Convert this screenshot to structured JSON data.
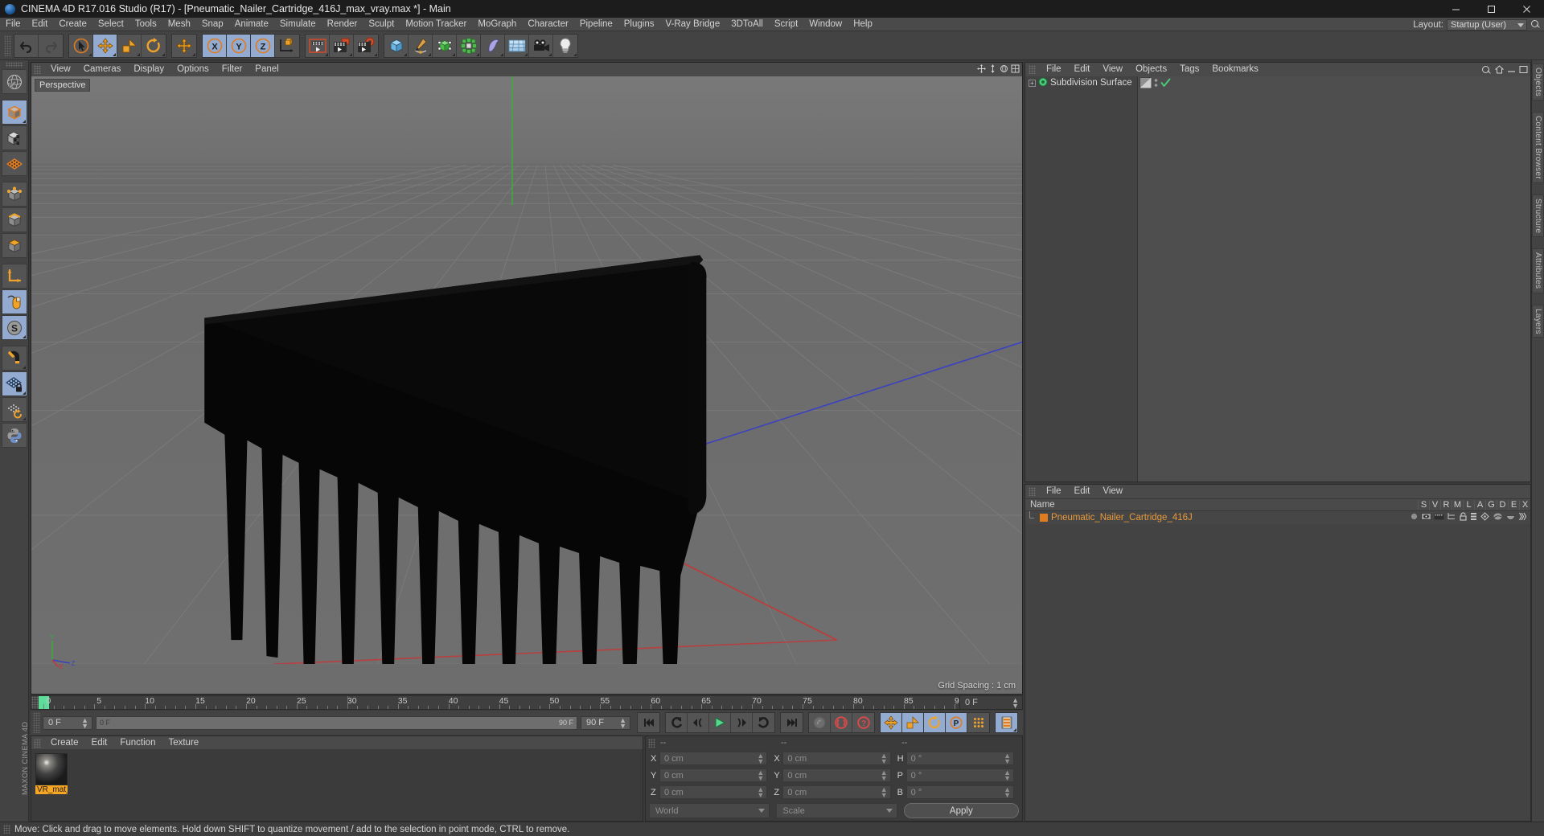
{
  "window": {
    "title": "CINEMA 4D R17.016 Studio (R17) - [Pneumatic_Nailer_Cartridge_416J_max_vray.max *] - Main",
    "minimize": "─",
    "maximize": "☐",
    "close": "✕"
  },
  "menubar": {
    "items": [
      "File",
      "Edit",
      "Create",
      "Select",
      "Tools",
      "Mesh",
      "Snap",
      "Animate",
      "Simulate",
      "Render",
      "Sculpt",
      "Motion Tracker",
      "MoGraph",
      "Character",
      "Pipeline",
      "Plugins",
      "V-Ray Bridge",
      "3DToAll",
      "Script",
      "Window",
      "Help"
    ],
    "layout_label": "Layout:",
    "layout_value": "Startup (User)",
    "search_icon": "search-icon"
  },
  "toolbar": {
    "groups": [
      {
        "name": "history",
        "buttons": [
          {
            "icon": "undo-icon",
            "label": "Undo",
            "active": false
          },
          {
            "icon": "redo-icon",
            "label": "Redo",
            "active": false
          }
        ]
      },
      {
        "name": "tools",
        "buttons": [
          {
            "icon": "live-selection-icon",
            "label": "Live Selection",
            "active": false
          },
          {
            "icon": "move-icon",
            "label": "Move",
            "active": true
          },
          {
            "icon": "scale-icon",
            "label": "Scale",
            "active": false
          },
          {
            "icon": "rotate-icon",
            "label": "Rotate",
            "active": false
          }
        ]
      },
      {
        "name": "transform",
        "buttons": [
          {
            "icon": "move-plus-icon",
            "label": "Move",
            "active": false
          }
        ]
      },
      {
        "name": "axes",
        "buttons": [
          {
            "icon": "x-axis-icon",
            "label": "X",
            "active": true
          },
          {
            "icon": "y-axis-icon",
            "label": "Y",
            "active": true
          },
          {
            "icon": "z-axis-icon",
            "label": "Z",
            "active": true
          },
          {
            "icon": "coordinate-system-icon",
            "label": "World/Object",
            "active": false
          }
        ]
      },
      {
        "name": "render",
        "buttons": [
          {
            "icon": "render-view-icon",
            "label": "Render View",
            "active": false
          },
          {
            "icon": "render-region-icon",
            "label": "Render to Picture Viewer",
            "active": false
          },
          {
            "icon": "render-settings-icon",
            "label": "Edit Render Settings",
            "active": false
          }
        ]
      },
      {
        "name": "objects",
        "buttons": [
          {
            "icon": "cube-primitive-icon",
            "label": "Cube",
            "active": false
          },
          {
            "icon": "spline-pen-icon",
            "label": "Spline Pen",
            "active": false
          },
          {
            "icon": "nurbs-icon",
            "label": "Subdivision Surface",
            "active": false
          },
          {
            "icon": "mograph-icon",
            "label": "MoGraph Cloner",
            "active": false
          },
          {
            "icon": "deformer-icon",
            "label": "Bend",
            "active": false
          },
          {
            "icon": "scene-floor-icon",
            "label": "Floor",
            "active": false
          },
          {
            "icon": "camera-icon",
            "label": "Camera",
            "active": false
          },
          {
            "icon": "light-icon",
            "label": "Light",
            "active": false
          }
        ]
      }
    ]
  },
  "lefttoolbar": {
    "buttons": [
      {
        "icon": "make-editable-icon",
        "label": "Make Editable",
        "active": false
      },
      {
        "icon": "model-mode-icon",
        "label": "Model Mode",
        "active": true
      },
      {
        "icon": "texture-mode-icon",
        "label": "Texture Mode",
        "active": false
      },
      {
        "icon": "workplane-mode-icon",
        "label": "Workplane Mode",
        "active": false
      },
      {
        "icon": "point-mode-icon",
        "label": "Points",
        "active": false
      },
      {
        "icon": "edge-mode-icon",
        "label": "Edges",
        "active": false
      },
      {
        "icon": "polygon-mode-icon",
        "label": "Polygons",
        "active": false
      },
      {
        "icon": "axis-mode-icon",
        "label": "Enable Axis",
        "active": false
      },
      {
        "icon": "viewport-solo-icon",
        "label": "Viewport Solo",
        "active": true
      },
      {
        "icon": "snap-scale-icon",
        "label": "Soft Selection",
        "active": true
      },
      {
        "icon": "magnet-icon",
        "label": "Magnet",
        "active": false
      },
      {
        "icon": "lock-workplane-icon",
        "label": "Lock Workplane",
        "active": true
      },
      {
        "icon": "planar-workplane-icon",
        "label": "Planar Workplane",
        "active": false
      },
      {
        "icon": "python-icon",
        "label": "Python",
        "active": false
      }
    ],
    "brand": "MAXON CINEMA 4D"
  },
  "viewport": {
    "menu": [
      "View",
      "Cameras",
      "Display",
      "Options",
      "Filter",
      "Panel"
    ],
    "label": "Perspective",
    "grid_spacing": "Grid Spacing : 1 cm",
    "axis_gizmo": {
      "y": "Y",
      "x": "X",
      "z": "Z"
    },
    "colors": {
      "sky": "#757575",
      "ground": "#6a6a6a",
      "object": "#0c0c0c",
      "x_axis": "#b33a3a",
      "z_axis": "#3a3fb3",
      "y_axis": "#3aa83a"
    }
  },
  "timeline": {
    "ticks": [
      0,
      5,
      10,
      15,
      20,
      25,
      30,
      35,
      40,
      45,
      50,
      55,
      60,
      65,
      70,
      75,
      80,
      85,
      90
    ],
    "start": 0,
    "end": 90,
    "playhead": 0,
    "current_frame_field": "0 F"
  },
  "transport": {
    "current_frame": "0 F",
    "range_start": "0 F",
    "range_end": "90 F",
    "end_frame": "90 F",
    "buttons": [
      {
        "icon": "go-to-start-icon",
        "label": "Go to Start"
      },
      {
        "icon": "previous-keyframe-icon",
        "label": "Go to Previous Key"
      },
      {
        "icon": "step-back-icon",
        "label": "Go to Previous Frame"
      },
      {
        "icon": "play-icon",
        "label": "Play"
      },
      {
        "icon": "step-forward-icon",
        "label": "Go to Next Frame"
      },
      {
        "icon": "next-keyframe-icon",
        "label": "Go to Next Key"
      },
      {
        "icon": "go-to-end-icon",
        "label": "Go to End"
      },
      {
        "icon": "record-active-objects-icon",
        "label": "Record Active Objects"
      },
      {
        "icon": "autokeying-icon",
        "label": "Autokeying"
      },
      {
        "icon": "keyframe-selection-icon",
        "label": "Keyframe Selection"
      },
      {
        "icon": "position-key-icon",
        "label": "Position"
      },
      {
        "icon": "scale-key-icon",
        "label": "Scale"
      },
      {
        "icon": "rotation-key-icon",
        "label": "Rotation"
      },
      {
        "icon": "parameter-key-icon",
        "label": "Parameter"
      },
      {
        "icon": "point-level-animation-icon",
        "label": "PLA"
      },
      {
        "icon": "dope-sheet-icon",
        "label": "Timeline"
      }
    ]
  },
  "material_manager": {
    "menu": [
      "Create",
      "Edit",
      "Function",
      "Texture"
    ],
    "materials": [
      {
        "name": "VR_mat_",
        "selected": true
      }
    ]
  },
  "coordinates": {
    "headers": [
      "--",
      "--",
      "--"
    ],
    "rows": [
      {
        "label1": "X",
        "value1": "0 cm",
        "label2": "X",
        "value2": "0 cm",
        "label3": "H",
        "value3": "0 °"
      },
      {
        "label1": "Y",
        "value1": "0 cm",
        "label2": "Y",
        "value2": "0 cm",
        "label3": "P",
        "value3": "0 °"
      },
      {
        "label1": "Z",
        "value1": "0 cm",
        "label2": "Z",
        "value2": "0 cm",
        "label3": "B",
        "value3": "0 °"
      }
    ],
    "coord_system": "World",
    "size_mode": "Scale",
    "apply": "Apply"
  },
  "object_manager": {
    "menu": [
      "File",
      "Edit",
      "View",
      "Objects",
      "Tags",
      "Bookmarks"
    ],
    "items": [
      {
        "name": "Subdivision Surface",
        "expandable": true,
        "icon": "subdivision-surface-icon"
      }
    ]
  },
  "layer_manager": {
    "menu": [
      "File",
      "Edit",
      "View"
    ],
    "columns": [
      "Name",
      "S",
      "V",
      "R",
      "M",
      "L",
      "A",
      "G",
      "D",
      "E",
      "X"
    ],
    "rows": [
      {
        "name": "Pneumatic_Nailer_Cartridge_416J",
        "color": "#e07b20"
      }
    ]
  },
  "right_tabs": [
    "Objects",
    "Content Browser",
    "Structure",
    "Attributes",
    "Layers"
  ],
  "statusbar": {
    "message": "Move: Click and drag to move elements. Hold down SHIFT to quantize movement / add to the selection in point mode, CTRL to remove."
  }
}
